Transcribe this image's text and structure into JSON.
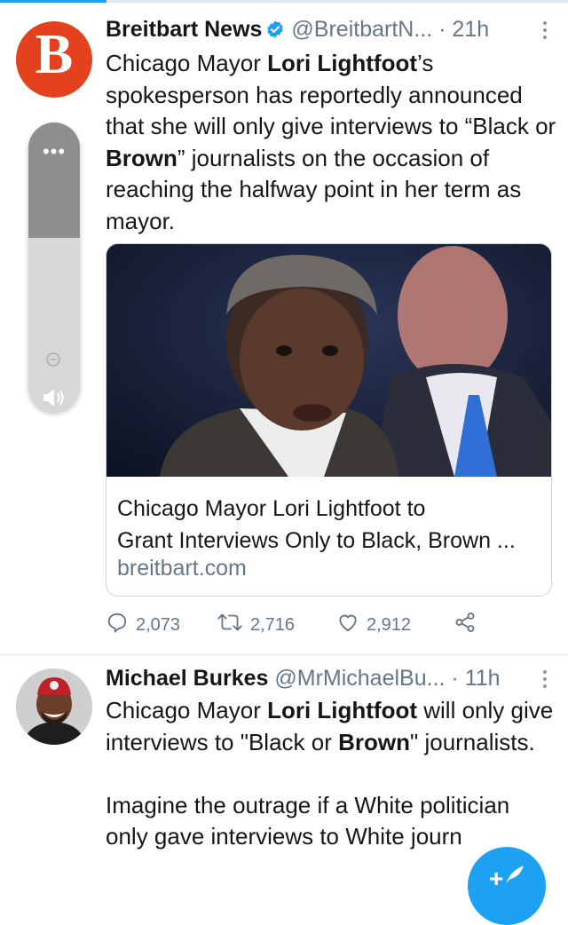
{
  "tweets": [
    {
      "name": "Breitbart News",
      "handle": "@BreitbartN...",
      "time": "· 21h",
      "avatar_letter": "B",
      "text": {
        "p1": "Chicago Mayor ",
        "b1": "Lori Lightfoot",
        "p2": "’s spokesperson has reportedly announced that she will only give interviews to “Black or ",
        "b2": "Brown",
        "p3": "” journalists on the occasion of reaching the halfway point in her term as mayor."
      },
      "card": {
        "title_line1": "Chicago Mayor Lori Lightfoot to",
        "title_line2": "Grant Interviews Only to Black, Brown ...",
        "domain": "breitbart.com"
      },
      "actions": {
        "replies": "2,073",
        "retweets": "2,716",
        "likes": "2,912"
      }
    },
    {
      "name": "Michael Burkes",
      "handle": "@MrMichaelBu...",
      "time": "· 11h",
      "text": {
        "p1": "Chicago Mayor ",
        "b1": "Lori Lightfoot",
        "p2": " will only give interviews to \"Black or ",
        "b2": "Brown",
        "p3": "\" journalists.",
        "p4": "Imagine the outrage if a White politician only gave interviews to White journ"
      }
    }
  ],
  "volume_overlay": {
    "dots": "•••",
    "level": 0.6
  },
  "colors": {
    "accent": "#1da1f2",
    "breitbart": "#e4421e",
    "muted": "#657786"
  },
  "icons": [
    "verified-icon",
    "more-icon",
    "reply-icon",
    "retweet-icon",
    "like-icon",
    "share-icon",
    "compose-icon",
    "volume-icon",
    "minus-icon"
  ]
}
